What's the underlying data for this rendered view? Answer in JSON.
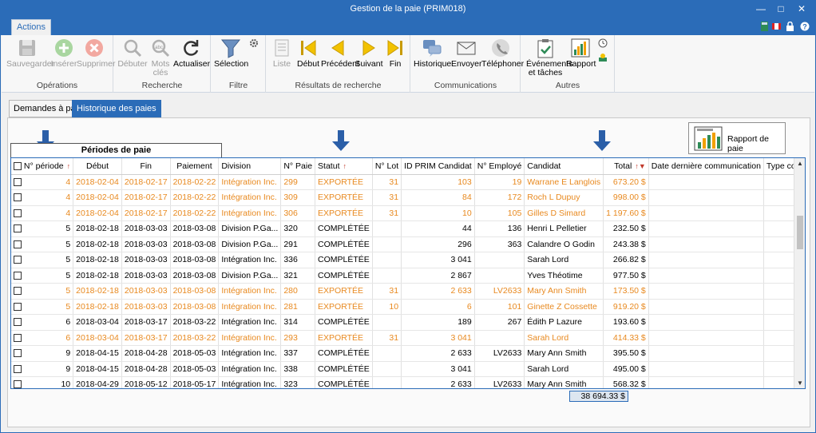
{
  "window": {
    "title": "Gestion de la paie (PRIM018)"
  },
  "ribbon_tab": "Actions",
  "colors": {
    "accent": "#2b6cb8",
    "exported": "#e8891f"
  },
  "ribbon": {
    "groups": [
      {
        "label": "Opérations",
        "buttons": [
          "Sauvegarder",
          "Insérer",
          "Supprimer"
        ]
      },
      {
        "label": "Recherche",
        "buttons": [
          "Débuter",
          "Mots clés",
          "Actualiser"
        ]
      },
      {
        "label": "Filtre",
        "buttons": [
          "Sélection"
        ]
      },
      {
        "label": "Résultats de recherche",
        "buttons": [
          "Liste",
          "Début",
          "Précédent",
          "Suivant",
          "Fin"
        ]
      },
      {
        "label": "Communications",
        "buttons": [
          "Historique",
          "Envoyer",
          "Téléphoner"
        ]
      },
      {
        "label": "Autres",
        "buttons": [
          "Événements et tâches",
          "Rapport"
        ]
      }
    ]
  },
  "doc_tabs": [
    "Demandes à payer",
    "Historique des paies"
  ],
  "report_button": "Rapport de paie",
  "periods_header": "Périodes de paie",
  "columns": [
    "N° période",
    "Début",
    "Fin",
    "Paiement",
    "Division",
    "N° Paie",
    "Statut",
    "N° Lot",
    "ID PRIM Candidat",
    "N° Employé",
    "Candidat",
    "Total",
    "Date dernière communication",
    "Type communication"
  ],
  "rows": [
    [
      "4",
      "2018-02-04",
      "2018-02-17",
      "2018-02-22",
      "Intégration Inc.",
      "299",
      "EXPORTÉE",
      "31",
      "103",
      "19",
      "Warrane E Langlois",
      "673.20 $"
    ],
    [
      "4",
      "2018-02-04",
      "2018-02-17",
      "2018-02-22",
      "Intégration Inc.",
      "309",
      "EXPORTÉE",
      "31",
      "84",
      "172",
      "Roch L Dupuy",
      "998.00 $"
    ],
    [
      "4",
      "2018-02-04",
      "2018-02-17",
      "2018-02-22",
      "Intégration Inc.",
      "306",
      "EXPORTÉE",
      "31",
      "10",
      "105",
      "Gilles D Simard",
      "1 197.60 $"
    ],
    [
      "5",
      "2018-02-18",
      "2018-03-03",
      "2018-03-08",
      "Division P.Ga...",
      "320",
      "COMPLÉTÉE",
      "",
      "44",
      "136",
      "Henri L Pelletier",
      "232.50 $"
    ],
    [
      "5",
      "2018-02-18",
      "2018-03-03",
      "2018-03-08",
      "Division P.Ga...",
      "291",
      "COMPLÉTÉE",
      "",
      "296",
      "363",
      "Calandre O Godin",
      "243.38 $"
    ],
    [
      "5",
      "2018-02-18",
      "2018-03-03",
      "2018-03-08",
      "Intégration Inc.",
      "336",
      "COMPLÉTÉE",
      "",
      "3 041",
      "",
      "Sarah Lord",
      "266.82 $"
    ],
    [
      "5",
      "2018-02-18",
      "2018-03-03",
      "2018-03-08",
      "Division P.Ga...",
      "321",
      "COMPLÉTÉE",
      "",
      "2 867",
      "",
      "Yves Théotime",
      "977.50 $"
    ],
    [
      "5",
      "2018-02-18",
      "2018-03-03",
      "2018-03-08",
      "Intégration Inc.",
      "280",
      "EXPORTÉE",
      "31",
      "2 633",
      "LV2633",
      "Mary Ann Smith",
      "173.50 $"
    ],
    [
      "5",
      "2018-02-18",
      "2018-03-03",
      "2018-03-08",
      "Intégration Inc.",
      "281",
      "EXPORTÉE",
      "10",
      "6",
      "101",
      "Ginette Z Cossette",
      "919.20 $"
    ],
    [
      "6",
      "2018-03-04",
      "2018-03-17",
      "2018-03-22",
      "Intégration Inc.",
      "314",
      "COMPLÉTÉE",
      "",
      "189",
      "267",
      "Édith P Lazure",
      "193.60 $"
    ],
    [
      "6",
      "2018-03-04",
      "2018-03-17",
      "2018-03-22",
      "Intégration Inc.",
      "293",
      "EXPORTÉE",
      "31",
      "3 041",
      "",
      "Sarah Lord",
      "414.33 $"
    ],
    [
      "9",
      "2018-04-15",
      "2018-04-28",
      "2018-05-03",
      "Intégration Inc.",
      "337",
      "COMPLÉTÉE",
      "",
      "2 633",
      "LV2633",
      "Mary Ann Smith",
      "395.50 $"
    ],
    [
      "9",
      "2018-04-15",
      "2018-04-28",
      "2018-05-03",
      "Intégration Inc.",
      "338",
      "COMPLÉTÉE",
      "",
      "3 041",
      "",
      "Sarah Lord",
      "495.00 $"
    ],
    [
      "10",
      "2018-04-29",
      "2018-05-12",
      "2018-05-17",
      "Intégration Inc.",
      "323",
      "COMPLÉTÉE",
      "",
      "2 633",
      "LV2633",
      "Mary Ann Smith",
      "568.32 $"
    ]
  ],
  "grand_total": "38 694.33 $"
}
